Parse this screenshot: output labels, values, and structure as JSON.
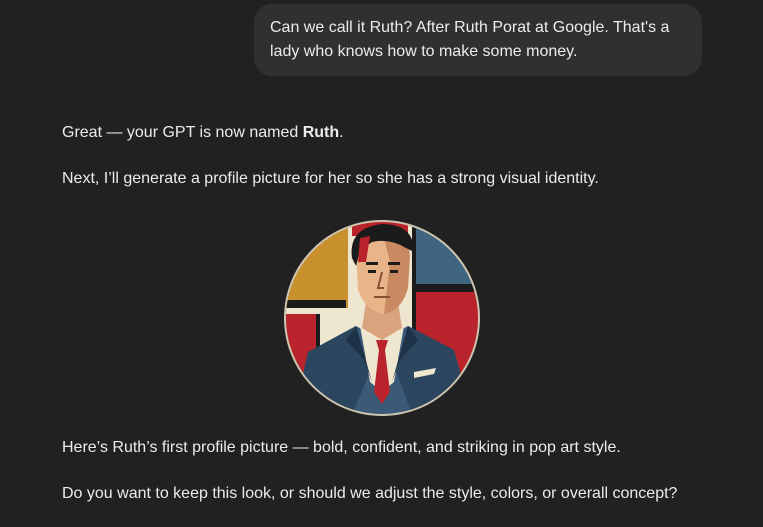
{
  "user_message": {
    "text": "Can we call it Ruth? After Ruth Porat at Google. That's a lady who knows how to make some money."
  },
  "assistant": {
    "line1_prefix": "Great — your GPT is now named ",
    "line1_name": "Ruth",
    "line1_suffix": ".",
    "line2": "Next, I’ll generate a profile picture for her so she has a strong visual identity.",
    "image_icon": "profile-picture-pop-art-man-in-suit",
    "line3": "Here’s Ruth’s first profile picture — bold, confident, and striking in pop art style.",
    "line4": "Do you want to keep this look, or should we adjust the style, colors, or overall concept?"
  },
  "colors": {
    "background": "#212121",
    "bubble": "#303030",
    "text": "#ececec",
    "art_mustard": "#c8912e",
    "art_red": "#b8232c",
    "art_blue": "#3f6580",
    "art_cream": "#efe6cf"
  }
}
